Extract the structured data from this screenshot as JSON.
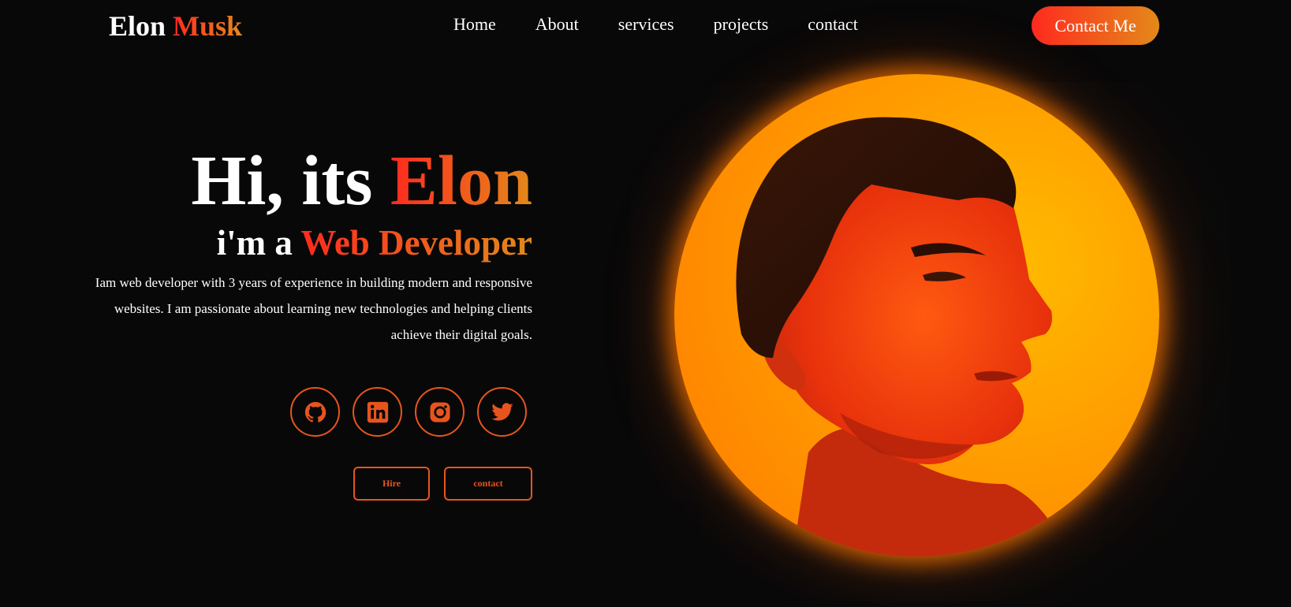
{
  "header": {
    "logo_first": "Elon",
    "logo_accent": "Musk",
    "nav": [
      "Home",
      "About",
      "services",
      "projects",
      "contact"
    ],
    "cta_label": "Contact Me"
  },
  "hero": {
    "title_plain": "Hi, its ",
    "title_accent": "Elon",
    "subtitle_plain": "i'm a ",
    "subtitle_accent": "Web Developer",
    "description": "Iam web developer with 3 years of experience in building modern and responsive websites. I am passionate about learning new technologies and helping clients achieve their digital goals.",
    "socials": [
      {
        "icon": "github-icon"
      },
      {
        "icon": "linkedin-icon"
      },
      {
        "icon": "instagram-icon"
      },
      {
        "icon": "twitter-icon"
      }
    ],
    "hire_label": "Hire",
    "contact_label": "contact"
  },
  "colors": {
    "background": "#080808",
    "accent_start": "#ff2a1f",
    "accent_end": "#e3891a",
    "icon_border": "#e8541e",
    "portrait_glow": "#ff9c00"
  }
}
